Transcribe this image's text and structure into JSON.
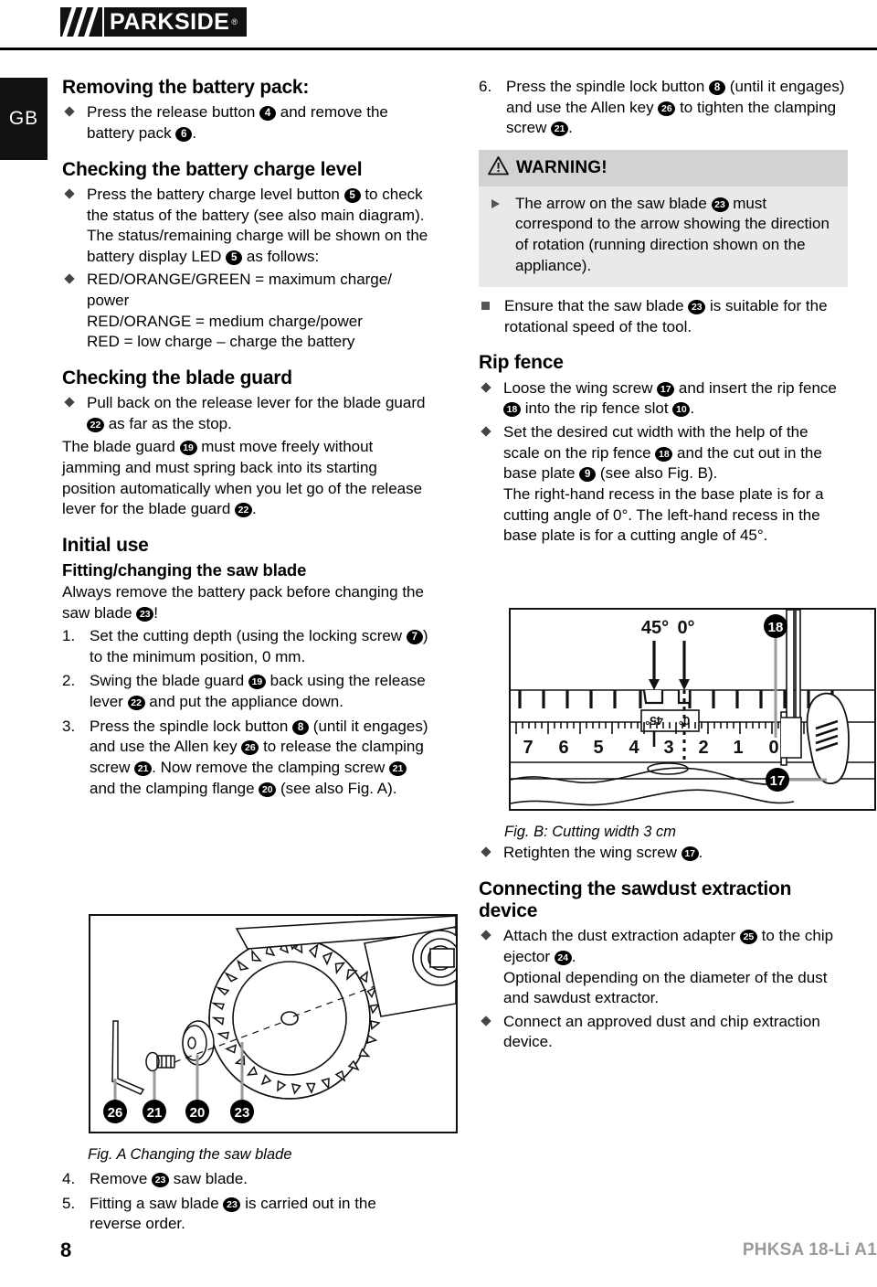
{
  "header": {
    "brand": "PARKSIDE",
    "registered_mark": "®",
    "country_code": "GB"
  },
  "left_column": {
    "heading_removing": "Removing the battery pack:",
    "removing_bullets": [
      "Press the release button [4] and remove the battery pack [6]."
    ],
    "heading_charge": "Checking the battery charge level",
    "charge_bullets": [
      "Press the battery charge level button [5] to check the status of the battery (see also main diagram). The status/remaining charge will be shown on the battery display LED [5] as follows:",
      "RED/ORANGE/GREEN = maximum charge/power\nRED/ORANGE = medium charge/power\nRED = low charge – charge the battery"
    ],
    "heading_blade_guard": "Checking the blade guard",
    "blade_guard_bullets": [
      "Pull back on the release lever for the blade guard [22] as far as the stop."
    ],
    "blade_guard_para": "The blade guard [19] must move freely without jamming and must spring back into its starting position automatically when you let go of the release lever for the blade guard [22].",
    "heading_initial_use": "Initial use",
    "heading_fitting": "Fitting/changing the saw blade",
    "fitting_para": "Always remove the battery pack before changing the saw blade [23]!",
    "steps": [
      {
        "num": "1.",
        "text": "Set the cutting depth (using the locking screw [7]) to the minimum position, 0 mm."
      },
      {
        "num": "2.",
        "text": "Swing the blade guard [19] back using the release lever [22] and put the appliance down."
      },
      {
        "num": "3.",
        "text": "Press the spindle lock button [8] (until it engages) and use the Allen key [26] to release the clamping screw [21]. Now remove the clamping screw [21] and the clamping flange [20] (see also Fig. A)."
      }
    ],
    "fig_a": {
      "caption": "Fig. A Changing the saw blade",
      "callouts": [
        "26",
        "21",
        "20",
        "23"
      ]
    },
    "steps_after_fig": [
      {
        "num": "4.",
        "text": "Remove [23] saw blade."
      },
      {
        "num": "5.",
        "text": "Fitting a saw blade [23] is carried out in the reverse order."
      }
    ]
  },
  "right_column": {
    "step6": {
      "num": "6.",
      "text": "Press the spindle lock button [8] (until it engages) and use the Allen key [26] to tighten the clamping screw [21]."
    },
    "warning": {
      "title": "WARNING!",
      "icon": "warning-triangle",
      "items": [
        "The arrow on the saw blade [23] must correspond to the arrow showing the direction of rotation (running direction shown on the appliance)."
      ],
      "head_bg": "#d2d2d2",
      "body_bg": "#e9e9e9"
    },
    "square_items": [
      "Ensure that the saw blade [23] is suitable for the rotational speed of the tool."
    ],
    "heading_rip_fence": "Rip fence",
    "rip_fence_bullets": [
      "Loose the wing screw [17] and insert the rip fence [18] into the rip fence slot [10].",
      "Set the desired cut width with the help of the scale on the rip fence [18] and the cut out in the base plate [9] (see also Fig. B).\nThe right-hand recess in the base plate is for a cutting angle of 0°. The left-hand recess in the base plate is for a cutting angle of 45°."
    ],
    "fig_b": {
      "caption": "Fig. B: Cutting width 3 cm",
      "label_45": "45°",
      "label_0": "0°",
      "inset_45": "45°",
      "inset_0": "0°",
      "ruler_ticks": [
        "7",
        "6",
        "5",
        "4",
        "3",
        "2",
        "1",
        "0"
      ],
      "callouts": [
        "18",
        "17"
      ]
    },
    "retighten_bullets": [
      "Retighten the wing screw [17]."
    ],
    "heading_sawdust": "Connecting the sawdust extraction device",
    "sawdust_bullets": [
      "Attach the dust extraction adapter [25] to the chip ejector [24].\nOptional depending on the diameter of the dust and sawdust extractor.",
      "Connect an approved dust and chip extraction device."
    ]
  },
  "footer": {
    "page_number": "8",
    "model": "PHKSA 18-Li A1",
    "model_color": "#9a9a9a"
  }
}
